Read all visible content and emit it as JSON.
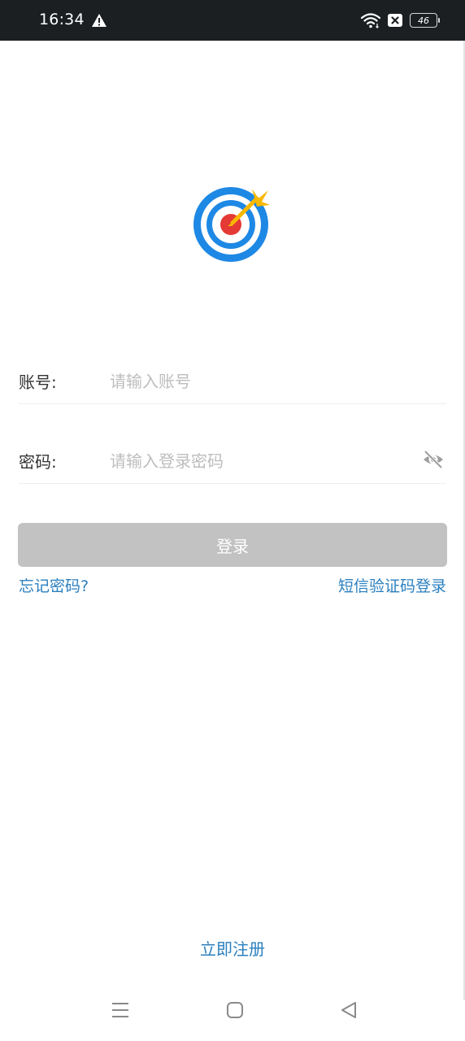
{
  "status_bar": {
    "time": "16:34",
    "battery_level": "46",
    "icons": [
      "warning-icon",
      "wifi-icon",
      "sim-blocked-icon",
      "battery-icon"
    ]
  },
  "logo": {
    "icon": "target-arrow-icon",
    "colors": {
      "ring_blue": "#1e88e5",
      "center_red": "#e53935",
      "arrow_yellow": "#f9b800"
    }
  },
  "form": {
    "account": {
      "label": "账号:",
      "placeholder": "请输入账号",
      "value": ""
    },
    "password": {
      "label": "密码:",
      "placeholder": "请输入登录密码",
      "value": "",
      "toggle_icon": "eye-off-icon"
    },
    "login_button": "登录",
    "forgot_link": "忘记密码?",
    "sms_login_link": "短信验证码登录"
  },
  "register_link": "立即注册",
  "colors": {
    "link": "#2a7fbf",
    "button_disabled": "#c2c2c2",
    "status_bar_bg": "#1b1f22"
  },
  "nav_bar": {
    "buttons": [
      "menu-icon",
      "home-icon",
      "back-icon"
    ]
  }
}
